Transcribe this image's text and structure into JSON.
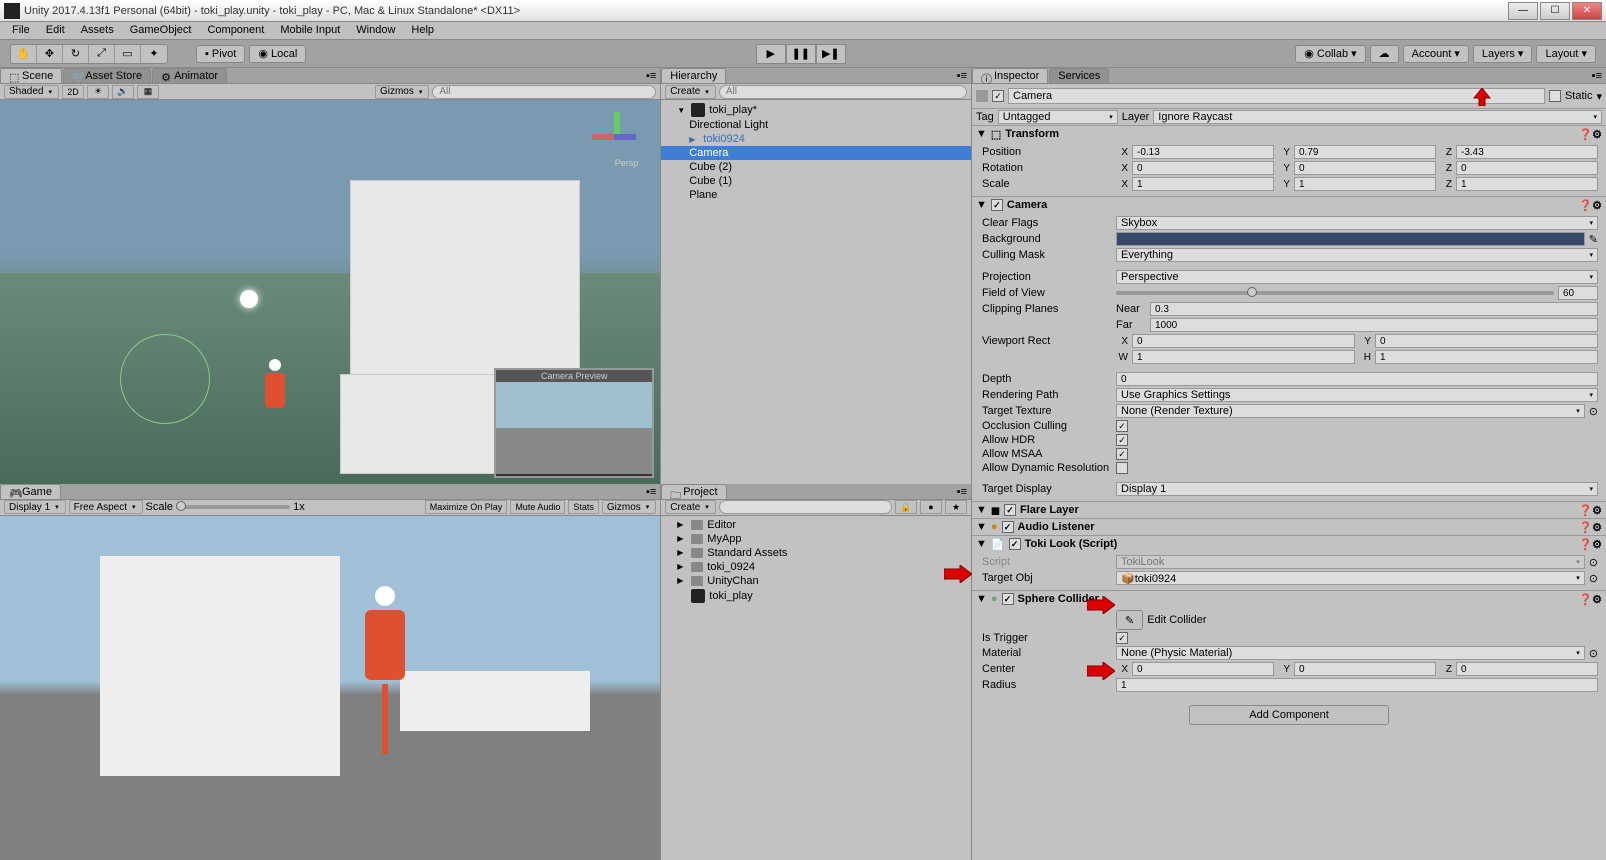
{
  "window": {
    "title": "Unity 2017.4.13f1 Personal (64bit) - toki_play.unity - toki_play - PC, Mac & Linux Standalone* <DX11>"
  },
  "menubar": [
    "File",
    "Edit",
    "Assets",
    "GameObject",
    "Component",
    "Mobile Input",
    "Window",
    "Help"
  ],
  "toolbar": {
    "pivot": "Pivot",
    "local": "Local",
    "collab": "Collab",
    "account": "Account",
    "layers": "Layers",
    "layout": "Layout"
  },
  "tabs": {
    "scene": "Scene",
    "assetStore": "Asset Store",
    "animator": "Animator",
    "game": "Game",
    "hierarchy": "Hierarchy",
    "project": "Project",
    "inspector": "Inspector",
    "services": "Services"
  },
  "sceneToolbar": {
    "shaded": "Shaded",
    "twoD": "2D",
    "gizmos": "Gizmos",
    "searchAll": "All"
  },
  "cameraPreview": "Camera Preview",
  "gameToolbar": {
    "display": "Display 1",
    "aspect": "Free Aspect",
    "scale": "Scale",
    "scaleValue": "1x",
    "maximize": "Maximize On Play",
    "mute": "Mute Audio",
    "stats": "Stats",
    "gizmos": "Gizmos"
  },
  "hierarchyToolbar": {
    "create": "Create",
    "searchAll": "All"
  },
  "hierarchy": {
    "root": "toki_play*",
    "items": [
      "Directional Light",
      "toki0924",
      "Camera",
      "Cube (2)",
      "Cube (1)",
      "Plane"
    ]
  },
  "projectToolbar": {
    "create": "Create"
  },
  "project": {
    "folders": [
      "Editor",
      "MyApp",
      "Standard Assets",
      "toki_0924",
      "UnityChan"
    ],
    "scene": "toki_play"
  },
  "inspector": {
    "name": "Camera",
    "static": "Static",
    "tagLabel": "Tag",
    "tag": "Untagged",
    "layerLabel": "Layer",
    "layer": "Ignore Raycast",
    "transform": {
      "title": "Transform",
      "position": "Position",
      "posX": "-0.13",
      "posY": "0.79",
      "posZ": "-3.43",
      "rotation": "Rotation",
      "rotX": "0",
      "rotY": "0",
      "rotZ": "0",
      "scale": "Scale",
      "sclX": "1",
      "sclY": "1",
      "sclZ": "1"
    },
    "camera": {
      "title": "Camera",
      "clearFlags": "Clear Flags",
      "clearFlagsVal": "Skybox",
      "background": "Background",
      "cullingMask": "Culling Mask",
      "cullingMaskVal": "Everything",
      "projection": "Projection",
      "projectionVal": "Perspective",
      "fov": "Field of View",
      "fovVal": "60",
      "clipping": "Clipping Planes",
      "near": "Near",
      "nearVal": "0.3",
      "far": "Far",
      "farVal": "1000",
      "viewport": "Viewport Rect",
      "vpX": "0",
      "vpY": "0",
      "vpW": "1",
      "vpH": "1",
      "depth": "Depth",
      "depthVal": "0",
      "renderPath": "Rendering Path",
      "renderPathVal": "Use Graphics Settings",
      "targetTex": "Target Texture",
      "targetTexVal": "None (Render Texture)",
      "occlusion": "Occlusion Culling",
      "hdr": "Allow HDR",
      "msaa": "Allow MSAA",
      "dynRes": "Allow Dynamic Resolution",
      "targetDisp": "Target Display",
      "targetDispVal": "Display 1"
    },
    "flare": "Flare Layer",
    "audio": "Audio Listener",
    "tokiLook": {
      "title": "Toki Look (Script)",
      "script": "Script",
      "scriptVal": "TokiLook",
      "targetObj": "Target Obj",
      "targetObjVal": "toki0924"
    },
    "sphere": {
      "title": "Sphere Collider",
      "editCollider": "Edit Collider",
      "isTrigger": "Is Trigger",
      "material": "Material",
      "materialVal": "None (Physic Material)",
      "center": "Center",
      "cx": "0",
      "cy": "0",
      "cz": "0",
      "radius": "Radius",
      "radiusVal": "1"
    },
    "addComponent": "Add Component"
  }
}
